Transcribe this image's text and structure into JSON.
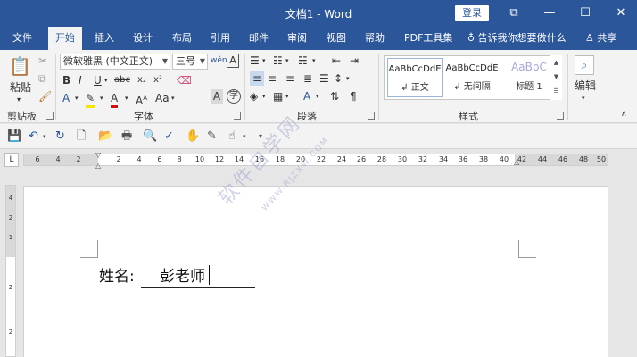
{
  "window": {
    "title": "文档1  -  Word",
    "login_label": "登录",
    "controls": [
      "⧉",
      "—",
      "☐",
      "✕"
    ]
  },
  "tabs": [
    {
      "label": "文件"
    },
    {
      "label": "开始"
    },
    {
      "label": "插入"
    },
    {
      "label": "设计"
    },
    {
      "label": "布局"
    },
    {
      "label": "引用"
    },
    {
      "label": "邮件"
    },
    {
      "label": "审阅"
    },
    {
      "label": "视图"
    },
    {
      "label": "帮助"
    },
    {
      "label": "PDF工具集"
    }
  ],
  "tell_me": "告诉我你想要做什么",
  "share": "共享",
  "clipboard": {
    "paste_label": "粘贴",
    "group_label": "剪贴板"
  },
  "font": {
    "family": "微软雅黑 (中文正文)",
    "size": "三号",
    "group_label": "字体"
  },
  "paragraph": {
    "group_label": "段落"
  },
  "styles": {
    "group_label": "样式",
    "items": [
      {
        "sample": "AaBbCcDdE",
        "name": "↲ 正文"
      },
      {
        "sample": "AaBbCcDdE",
        "name": "↲ 无间隔"
      },
      {
        "sample": "AaBbC",
        "name": "标题 1"
      }
    ]
  },
  "editing": {
    "label": "编辑"
  },
  "ruler": {
    "corner": "L",
    "numbers": [
      "6",
      "4",
      "2",
      "2",
      "4",
      "6",
      "8",
      "10",
      "12",
      "14",
      "16",
      "18",
      "20",
      "22",
      "24",
      "26",
      "28",
      "30",
      "32",
      "34",
      "36",
      "38",
      "40",
      "42",
      "44",
      "46",
      "48",
      "50"
    ]
  },
  "vruler": {
    "numbers": [
      "4",
      "2",
      "1",
      "2",
      "2"
    ]
  },
  "document": {
    "label": "姓名:",
    "value": "彭老师"
  },
  "watermark": {
    "text": "软件自学网",
    "sub": "WWW.RJZXW.COM"
  },
  "colors": {
    "accent": "#2b579a",
    "ribbon_bg": "#f3f3f3",
    "workspace_bg": "#e6e6e6"
  }
}
